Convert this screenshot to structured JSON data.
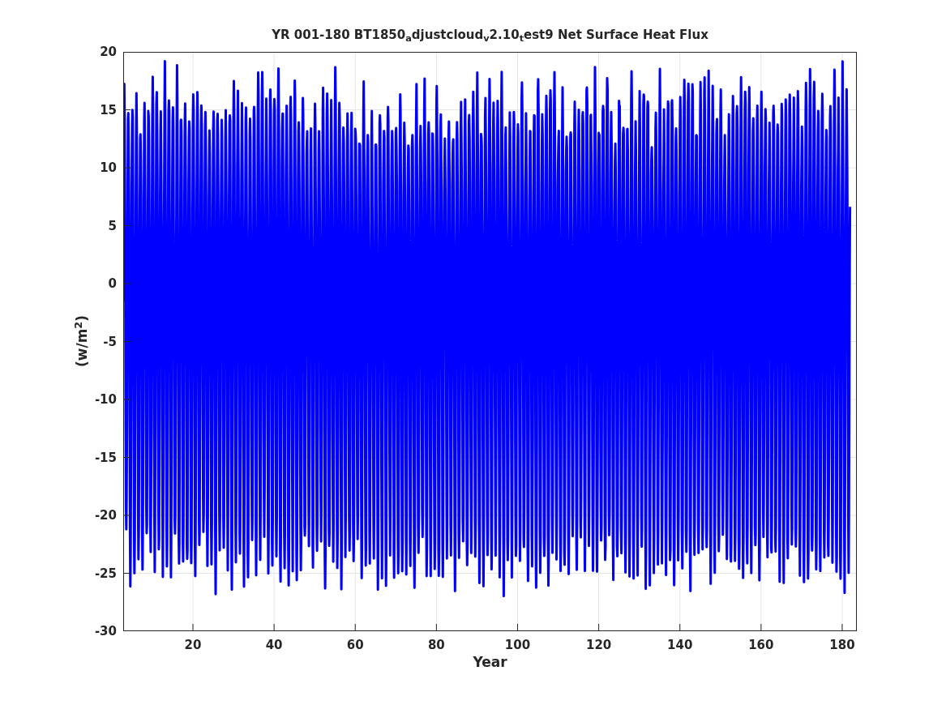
{
  "figure": {
    "title": "YR 001-180 BT1850$_{a}$djustcloud$_{v}$2.10$_{t}$est9 Net Surface Heat Flux",
    "xlabel": "Year",
    "ylabel": "(w/m$^{2}$)",
    "xticks": [
      "20",
      "40",
      "60",
      "80",
      "100",
      "120",
      "140",
      "160",
      "180"
    ],
    "yticks": [
      "20",
      "15",
      "10",
      "5",
      "0",
      "-5",
      "-10",
      "-15",
      "-20",
      "-25",
      "-30"
    ]
  }
}
